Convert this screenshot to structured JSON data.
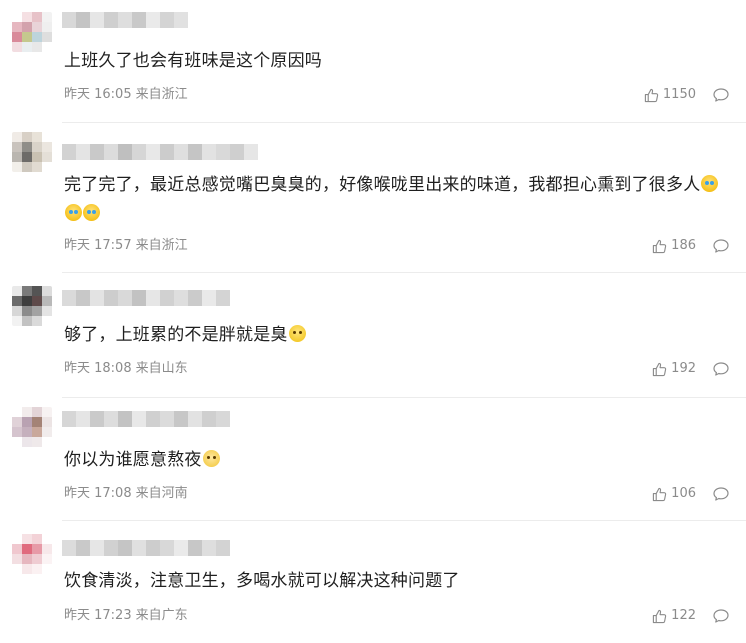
{
  "colors": {
    "text": "#1f1f1f",
    "meta": "#8b8b8b",
    "divider": "#ececec"
  },
  "comments": [
    {
      "text": "上班久了也会有班味是这个原因吗",
      "time": "昨天 16:05",
      "location": "来自浙江",
      "likes": "1150",
      "emojis": [],
      "avatar_colors": [
        "#ffffff",
        "#f5e0e3",
        "#e7c2c8",
        "#f2f2f2",
        "#e6b7c0",
        "#d3a2ac",
        "#e9d3d8",
        "#efefef",
        "#d98a9a",
        "#c5c88e",
        "#bdd4dc",
        "#dedede",
        "#f2dde1",
        "#e9eef0",
        "#e8e8e8",
        "#ffffff"
      ],
      "name_colors": [
        "#d8d8d8",
        "#c4c4c4",
        "#e6e6e6",
        "#cfcfcf",
        "#dedede",
        "#c9c9c9",
        "#eaeaea",
        "#d4d4d4",
        "#e1e1e1"
      ]
    },
    {
      "text": "完了完了，最近总感觉嘴巴臭臭的，好像喉咙里出来的味道，我都担心熏到了很多人",
      "time": "昨天 17:57",
      "location": "来自浙江",
      "likes": "186",
      "emojis": [
        "laugh-emoji",
        "laugh-emoji",
        "laugh-emoji"
      ],
      "avatar_colors": [
        "#f0ebe6",
        "#d8d0c6",
        "#e8e2d8",
        "#ffffff",
        "#c9c3bd",
        "#8f8d88",
        "#d9d3c9",
        "#ebe6df",
        "#bab6b0",
        "#6d6b68",
        "#c9c1b2",
        "#e4dfd7",
        "#f2efea",
        "#cfc9bf",
        "#e1dbd1",
        "#ffffff"
      ],
      "name_colors": [
        "#d2d2d2",
        "#e4e4e4",
        "#c9c9c9",
        "#dcdcdc",
        "#bfbfbf",
        "#d6d6d6",
        "#e8e8e8",
        "#cccccc",
        "#dfdfdf",
        "#c5c5c5",
        "#e2e2e2",
        "#d9d9d9",
        "#cfcfcf",
        "#e6e6e6"
      ]
    },
    {
      "text": "够了，上班累的不是胖就是臭",
      "time": "昨天 18:08",
      "location": "来自山东",
      "likes": "192",
      "emojis": [
        "smile-emoji"
      ],
      "avatar_colors": [
        "#e9e9e9",
        "#7a7a7a",
        "#545454",
        "#dcdcdc",
        "#6b6b6b",
        "#3e3e3e",
        "#5e4a4a",
        "#b9b9b9",
        "#d7d7d7",
        "#8c8c8c",
        "#a3a3a3",
        "#e4e4e4",
        "#f2f2f2",
        "#c2c2c2",
        "#dadada",
        "#ffffff"
      ],
      "name_colors": [
        "#dadada",
        "#c8c8c8",
        "#e3e3e3",
        "#cdcdcd",
        "#d9d9d9",
        "#c2c2c2",
        "#e6e6e6",
        "#d1d1d1",
        "#dedede",
        "#cbcbcb",
        "#e9e9e9",
        "#d4d4d4"
      ]
    },
    {
      "text": "你以为谁愿意熬夜",
      "time": "昨天 17:08",
      "location": "来自河南",
      "likes": "106",
      "emojis": [
        "blush-emoji"
      ],
      "avatar_colors": [
        "#ffffff",
        "#f2ecec",
        "#e3d4d7",
        "#f7f2f2",
        "#e0d2d8",
        "#b9a2b2",
        "#a48376",
        "#ece4e4",
        "#d5c4ce",
        "#c5b0bd",
        "#c9a89b",
        "#f1ecec",
        "#ffffff",
        "#ece6ea",
        "#efe9ea",
        "#ffffff"
      ],
      "name_colors": [
        "#d6d6d6",
        "#e5e5e5",
        "#cacaca",
        "#dddddd",
        "#c3c3c3",
        "#e8e8e8",
        "#d0d0d0",
        "#dbdbdb",
        "#c7c7c7",
        "#e2e2e2",
        "#cfcfcf",
        "#d8d8d8"
      ]
    },
    {
      "text": "饮食清淡，注意卫生，多喝水就可以解决这种问题了",
      "time": "昨天 17:23",
      "location": "来自广东",
      "likes": "122",
      "emojis": [],
      "avatar_colors": [
        "#ffffff",
        "#f6e1e4",
        "#f3d2d7",
        "#ffffff",
        "#f0c8cf",
        "#e06b7e",
        "#e79aa7",
        "#f7e8ea",
        "#f3dfe2",
        "#e6b7bf",
        "#efccd2",
        "#fbf3f4",
        "#ffffff",
        "#f7e8ea",
        "#fbf1f2",
        "#ffffff"
      ],
      "name_colors": [
        "#dcdcdc",
        "#c9c9c9",
        "#e6e6e6",
        "#d1d1d1",
        "#c5c5c5",
        "#e0e0e0",
        "#cdcdcd",
        "#d8d8d8",
        "#eaeaea",
        "#c7c7c7",
        "#dedede",
        "#d3d3d3"
      ]
    }
  ]
}
